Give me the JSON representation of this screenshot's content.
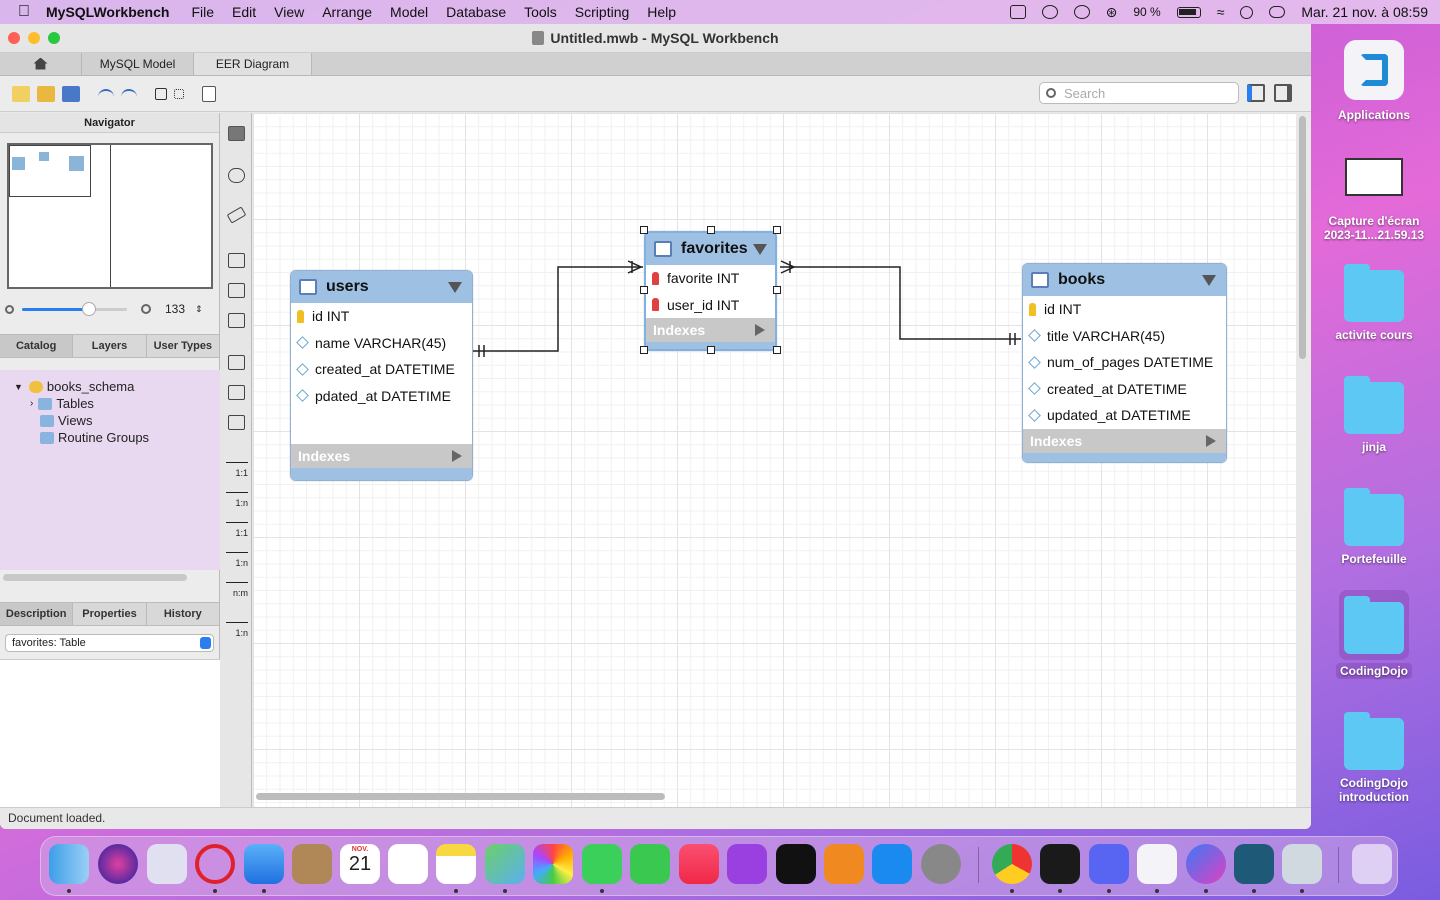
{
  "menubar": {
    "app": "MySQLWorkbench",
    "items": [
      "File",
      "Edit",
      "View",
      "Arrange",
      "Model",
      "Database",
      "Tools",
      "Scripting",
      "Help"
    ],
    "battery": "90 %",
    "datetime": "Mar. 21 nov. à  08:59"
  },
  "window": {
    "title": "Untitled.mwb - MySQL Workbench",
    "tabs": [
      "MySQL Model",
      "EER Diagram"
    ],
    "search_placeholder": "Search",
    "status": "Document loaded."
  },
  "navigator": {
    "title": "Navigator",
    "zoom": "133"
  },
  "left_tabs": [
    "Catalog",
    "Layers",
    "User Types"
  ],
  "tree": {
    "schema": "books_schema",
    "children": [
      "Tables",
      "Views",
      "Routine Groups"
    ]
  },
  "bottom_tabs": [
    "Description",
    "Properties",
    "History"
  ],
  "selection": "favorites: Table",
  "relationship_tools": [
    "1:1",
    "1:n",
    "1:1",
    "1:n",
    "n:m",
    "1:n"
  ],
  "tables": {
    "users": {
      "name": "users",
      "columns": [
        "id INT",
        "name VARCHAR(45)",
        "created_at DATETIME",
        "pdated_at DATETIME"
      ],
      "indexes": "Indexes"
    },
    "favorites": {
      "name": "favorites",
      "columns": [
        "favorite INT",
        "user_id INT"
      ],
      "indexes": "Indexes"
    },
    "books": {
      "name": "books",
      "columns": [
        "id INT",
        "title VARCHAR(45)",
        "num_of_pages DATETIME",
        "created_at DATETIME",
        "updated_at DATETIME"
      ],
      "indexes": "Indexes"
    }
  },
  "dock": {
    "calendar_month": "NOV.",
    "calendar_day": "21"
  },
  "desktop": [
    "Applications",
    "Capture d'écran 2023-11...21.59.13",
    "activite cours",
    "jinja",
    "Portefeuille",
    "CodingDojo",
    "CodingDojo introduction"
  ],
  "colors": {
    "table_header": "#9ec0e3",
    "accent": "#2a7ff0"
  }
}
